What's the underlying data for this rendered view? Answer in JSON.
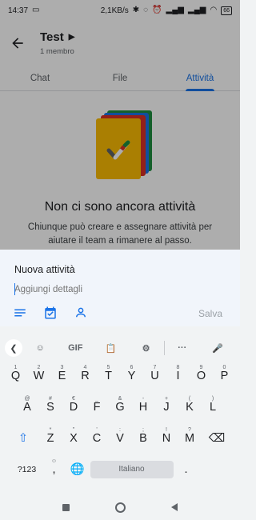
{
  "status_bar": {
    "time": "14:37",
    "network_speed": "2,1KB/s",
    "battery": "66"
  },
  "header": {
    "title": "Test",
    "subtitle": "1 membro"
  },
  "tabs": [
    {
      "label": "Chat",
      "active": false
    },
    {
      "label": "File",
      "active": false
    },
    {
      "label": "Attività",
      "active": true
    }
  ],
  "empty_state": {
    "title": "Non ci sono ancora attività",
    "description": "Chiunque può creare e assegnare attività per aiutare il team a rimanere al passo."
  },
  "task_sheet": {
    "title": "Nuova attività",
    "details_placeholder": "Aggiungi dettagli",
    "save_label": "Salva"
  },
  "keyboard": {
    "toolbar": {
      "gif_label": "GIF",
      "more_label": "···"
    },
    "row1": [
      {
        "key": "Q",
        "sup": "1"
      },
      {
        "key": "W",
        "sup": "2"
      },
      {
        "key": "E",
        "sup": "3"
      },
      {
        "key": "R",
        "sup": "4"
      },
      {
        "key": "T",
        "sup": "5"
      },
      {
        "key": "Y",
        "sup": "6"
      },
      {
        "key": "U",
        "sup": "7"
      },
      {
        "key": "I",
        "sup": "8"
      },
      {
        "key": "O",
        "sup": "9"
      },
      {
        "key": "P",
        "sup": "0"
      }
    ],
    "row2": [
      {
        "key": "A",
        "sup": "@"
      },
      {
        "key": "S",
        "sup": "#"
      },
      {
        "key": "D",
        "sup": "€"
      },
      {
        "key": "F",
        "sup": "_"
      },
      {
        "key": "G",
        "sup": "&"
      },
      {
        "key": "H",
        "sup": "-"
      },
      {
        "key": "J",
        "sup": "+"
      },
      {
        "key": "K",
        "sup": "("
      },
      {
        "key": "L",
        "sup": ")"
      }
    ],
    "row3": [
      {
        "key": "Z",
        "sup": "*"
      },
      {
        "key": "X",
        "sup": "\""
      },
      {
        "key": "C",
        "sup": "'"
      },
      {
        "key": "V",
        "sup": ":"
      },
      {
        "key": "B",
        "sup": ";"
      },
      {
        "key": "N",
        "sup": "!"
      },
      {
        "key": "M",
        "sup": "?"
      }
    ],
    "symbols_label": "?123",
    "comma_label": ",",
    "space_label": "Italiano",
    "period_label": ".",
    "accent_color": "#1a73e8"
  }
}
